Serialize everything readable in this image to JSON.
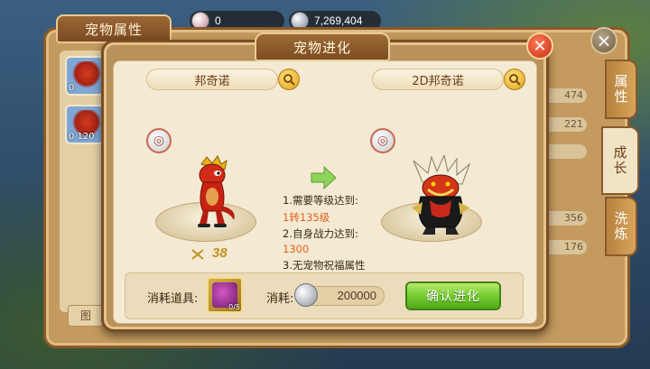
{
  "currency": {
    "diamond_value": "0",
    "silver_value": "7,269,404"
  },
  "back_panel": {
    "title": "宠物属性",
    "tabs": [
      "属性",
      "成长",
      "洗炼"
    ],
    "stats": [
      "474",
      "221",
      "",
      "356",
      "176"
    ],
    "pets": [
      {
        "level": "0"
      },
      {
        "level": "0 120"
      }
    ],
    "bottom_button": "图"
  },
  "dialog": {
    "title": "宠物进化",
    "current_pet_name": "邦奇诺",
    "evolved_pet_name": "2D邦奇诺",
    "current_level": "38",
    "requirements": {
      "line1": "1.需要等级达到:",
      "line1_value": "1转135级",
      "line2": "2.自身战力达到:",
      "line2_value": "1300",
      "line3": "3.无宠物祝福属性"
    },
    "cost_item_label": "消耗道具:",
    "cost_label": "消耗:",
    "cost_value": "200000",
    "item_count": "0/5",
    "confirm_label": "确认进化"
  },
  "colors": {
    "requirement_highlight": "#e0601e",
    "confirm_green": "#6ec82b",
    "close_red": "#c62d18"
  }
}
